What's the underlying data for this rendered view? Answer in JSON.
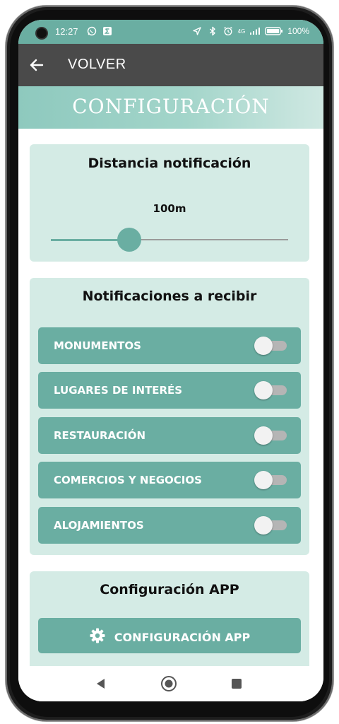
{
  "status_bar": {
    "time": "12:27",
    "battery": "100%",
    "network": "4G"
  },
  "app_bar": {
    "back_label": "VOLVER"
  },
  "banner": {
    "title": "CONFIGURACIÓN"
  },
  "distance": {
    "title": "Distancia notificación",
    "value_label": "100m",
    "slider_fraction": 0.33
  },
  "notifications": {
    "title": "Notificaciones a recibir",
    "items": [
      {
        "label": "MONUMENTOS",
        "enabled": false
      },
      {
        "label": "LUGARES DE INTERÉS",
        "enabled": false
      },
      {
        "label": "RESTAURACIÓN",
        "enabled": false
      },
      {
        "label": "COMERCIOS Y NEGOCIOS",
        "enabled": false
      },
      {
        "label": "ALOJAMIENTOS",
        "enabled": false
      }
    ]
  },
  "app_config": {
    "title": "Configuración APP",
    "button_label": "CONFIGURACIÓN APP",
    "button_icon": "gear-icon"
  },
  "colors": {
    "accent": "#6aaea2",
    "card_background": "#d4ebe5",
    "app_bar": "#4a4a4a"
  }
}
